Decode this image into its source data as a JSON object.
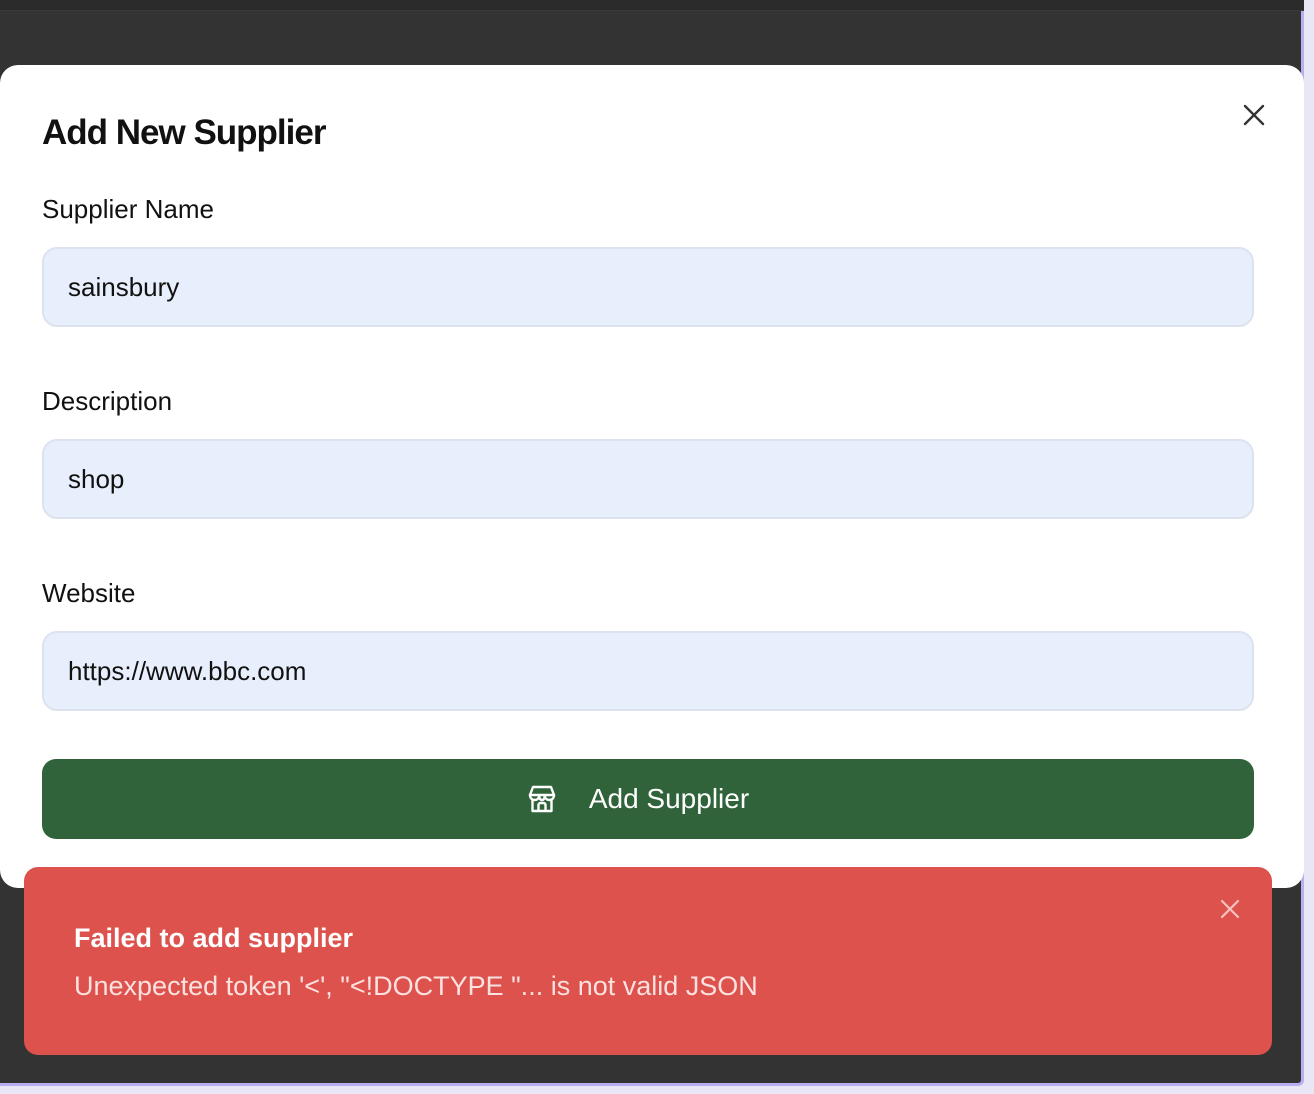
{
  "dialog": {
    "title": "Add New Supplier",
    "close_icon": "close-icon"
  },
  "form": {
    "supplier_name": {
      "label": "Supplier Name",
      "value": "sainsbury"
    },
    "description": {
      "label": "Description",
      "value": "shop"
    },
    "website": {
      "label": "Website",
      "value": "https://www.bbc.com"
    },
    "submit": {
      "label": "Add Supplier",
      "icon": "store-icon"
    }
  },
  "toast": {
    "title": "Failed to add supplier",
    "message": "Unexpected token '<', \"<!DOCTYPE \"... is not valid JSON",
    "close_icon": "close-icon"
  },
  "colors": {
    "backdrop": "#333333",
    "input_background": "#e8effc",
    "primary_button": "#30633a",
    "error_toast": "#dd524c"
  }
}
